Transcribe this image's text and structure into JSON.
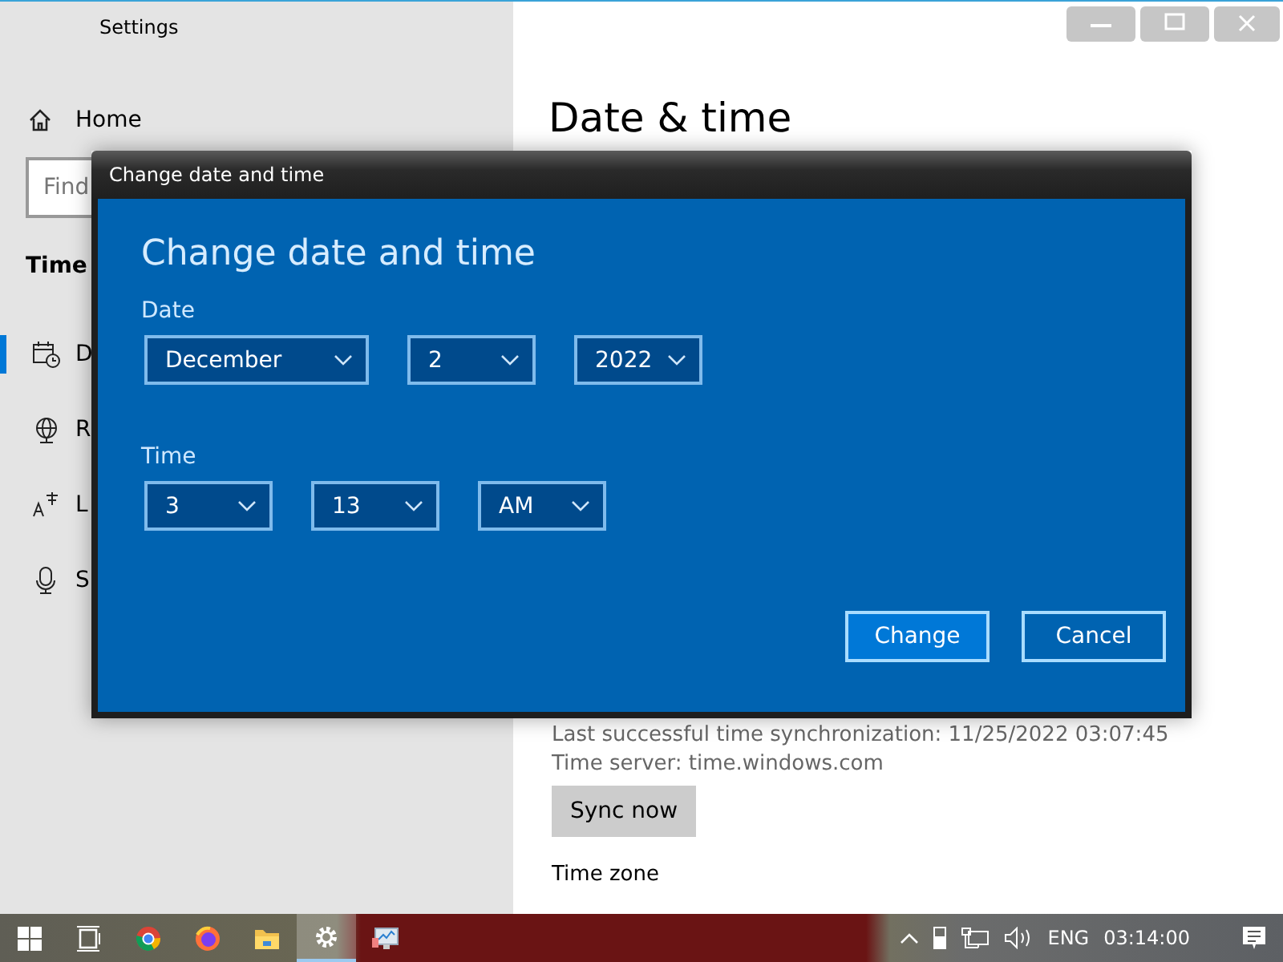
{
  "window": {
    "title": "Settings"
  },
  "sidebar": {
    "home": "Home",
    "search": {
      "placeholder": "Find"
    },
    "section": "Time",
    "items": [
      {
        "label": "D",
        "selected": true
      },
      {
        "label": "R",
        "selected": false
      },
      {
        "label": "L",
        "selected": false
      },
      {
        "label": "S",
        "selected": false
      }
    ]
  },
  "main": {
    "heading": "Date & time",
    "sync_info": "Last successful time synchronization: 11/25/2022 03:07:45",
    "time_server": "Time server: time.windows.com",
    "sync_button": "Sync now",
    "time_zone_label": "Time zone"
  },
  "dialog": {
    "title": "Change date and time",
    "heading": "Change date and time",
    "date_label": "Date",
    "date_fields": [
      {
        "value": "December"
      },
      {
        "value": "2"
      },
      {
        "value": "2022"
      }
    ],
    "time_label": "Time",
    "time_fields": [
      {
        "value": "3"
      },
      {
        "value": "13"
      },
      {
        "value": "AM"
      }
    ],
    "buttons": [
      {
        "label": "Change",
        "kind": "primary"
      },
      {
        "label": "Cancel",
        "kind": "secondary"
      }
    ]
  },
  "taskbar": {
    "apps": [
      {
        "active": false
      },
      {
        "active": false
      },
      {
        "active": false
      },
      {
        "active": false
      },
      {
        "active": true
      },
      {
        "active": false
      }
    ],
    "language": "ENG",
    "clock": "03:14:00"
  }
}
